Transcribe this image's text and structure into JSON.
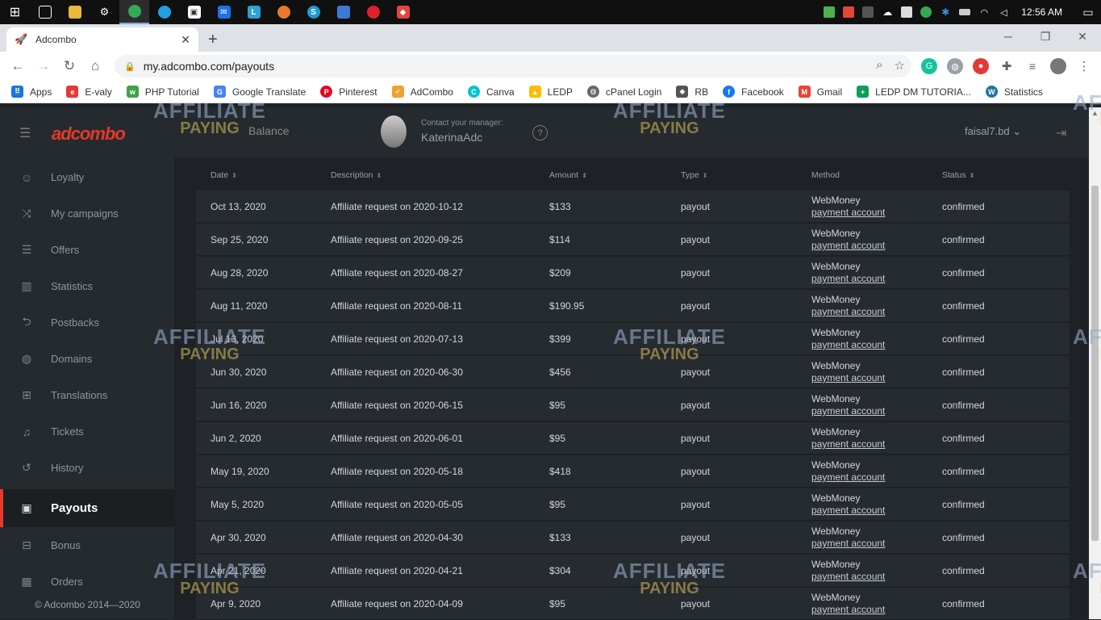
{
  "taskbar": {
    "clock": "12:56 AM"
  },
  "browser": {
    "tab_title": "Adcombo",
    "url": "my.adcombo.com/payouts",
    "bookmarks": [
      "Apps",
      "E-valy",
      "PHP Tutorial",
      "Google Translate",
      "Pinterest",
      "AdCombo",
      "Canva",
      "LEDP",
      "cPanel Login",
      "RB",
      "Facebook",
      "Gmail",
      "LEDP DM TUTORIA...",
      "Statistics"
    ]
  },
  "header": {
    "logo": "adcombo",
    "balance": "Balance",
    "manager_caption": "Contact your manager:",
    "manager_name": "KaterinaAdc",
    "help": "?",
    "user": "faisal7.bd"
  },
  "sidebar": {
    "items": [
      "Loyalty",
      "My campaigns",
      "Offers",
      "Statistics",
      "Postbacks",
      "Domains",
      "Translations",
      "Tickets",
      "History",
      "Payouts",
      "Bonus",
      "Orders"
    ],
    "active": "Payouts",
    "copyright": "© Adcombo 2014—2020"
  },
  "table": {
    "headers": [
      "Date",
      "Description",
      "Amount",
      "Type",
      "Method",
      "Status"
    ],
    "rows": [
      {
        "date": "Oct 13, 2020",
        "desc": "Affiliate request on 2020-10-12",
        "amount": "$133",
        "type": "payout",
        "method": "WebMoney",
        "account": "payment account",
        "status": "confirmed"
      },
      {
        "date": "Sep 25, 2020",
        "desc": "Affiliate request on 2020-09-25",
        "amount": "$114",
        "type": "payout",
        "method": "WebMoney",
        "account": "payment account",
        "status": "confirmed"
      },
      {
        "date": "Aug 28, 2020",
        "desc": "Affiliate request on 2020-08-27",
        "amount": "$209",
        "type": "payout",
        "method": "WebMoney",
        "account": "payment account",
        "status": "confirmed"
      },
      {
        "date": "Aug 11, 2020",
        "desc": "Affiliate request on 2020-08-11",
        "amount": "$190.95",
        "type": "payout",
        "method": "WebMoney",
        "account": "payment account",
        "status": "confirmed"
      },
      {
        "date": "Jul 13, 2020",
        "desc": "Affiliate request on 2020-07-13",
        "amount": "$399",
        "type": "payout",
        "method": "WebMoney",
        "account": "payment account",
        "status": "confirmed"
      },
      {
        "date": "Jun 30, 2020",
        "desc": "Affiliate request on 2020-06-30",
        "amount": "$456",
        "type": "payout",
        "method": "WebMoney",
        "account": "payment account",
        "status": "confirmed"
      },
      {
        "date": "Jun 16, 2020",
        "desc": "Affiliate request on 2020-06-15",
        "amount": "$95",
        "type": "payout",
        "method": "WebMoney",
        "account": "payment account",
        "status": "confirmed"
      },
      {
        "date": "Jun 2, 2020",
        "desc": "Affiliate request on 2020-06-01",
        "amount": "$95",
        "type": "payout",
        "method": "WebMoney",
        "account": "payment account",
        "status": "confirmed"
      },
      {
        "date": "May 19, 2020",
        "desc": "Affiliate request on 2020-05-18",
        "amount": "$418",
        "type": "payout",
        "method": "WebMoney",
        "account": "payment account",
        "status": "confirmed"
      },
      {
        "date": "May 5, 2020",
        "desc": "Affiliate request on 2020-05-05",
        "amount": "$95",
        "type": "payout",
        "method": "WebMoney",
        "account": "payment account",
        "status": "confirmed"
      },
      {
        "date": "Apr 30, 2020",
        "desc": "Affiliate request on 2020-04-30",
        "amount": "$133",
        "type": "payout",
        "method": "WebMoney",
        "account": "payment account",
        "status": "confirmed"
      },
      {
        "date": "Apr 21, 2020",
        "desc": "Affiliate request on 2020-04-21",
        "amount": "$304",
        "type": "payout",
        "method": "WebMoney",
        "account": "payment account",
        "status": "confirmed"
      },
      {
        "date": "Apr 9, 2020",
        "desc": "Affiliate request on 2020-04-09",
        "amount": "$95",
        "type": "payout",
        "method": "WebMoney",
        "account": "payment account",
        "status": "confirmed"
      }
    ]
  },
  "watermark": {
    "line1": "AFFILIATE",
    "line2": "PAYING"
  },
  "colors": {
    "accent": "#e6392b",
    "sidebar_bg": "#252a2e",
    "content_bg": "#1e2226",
    "row_bg": "#262b30"
  }
}
